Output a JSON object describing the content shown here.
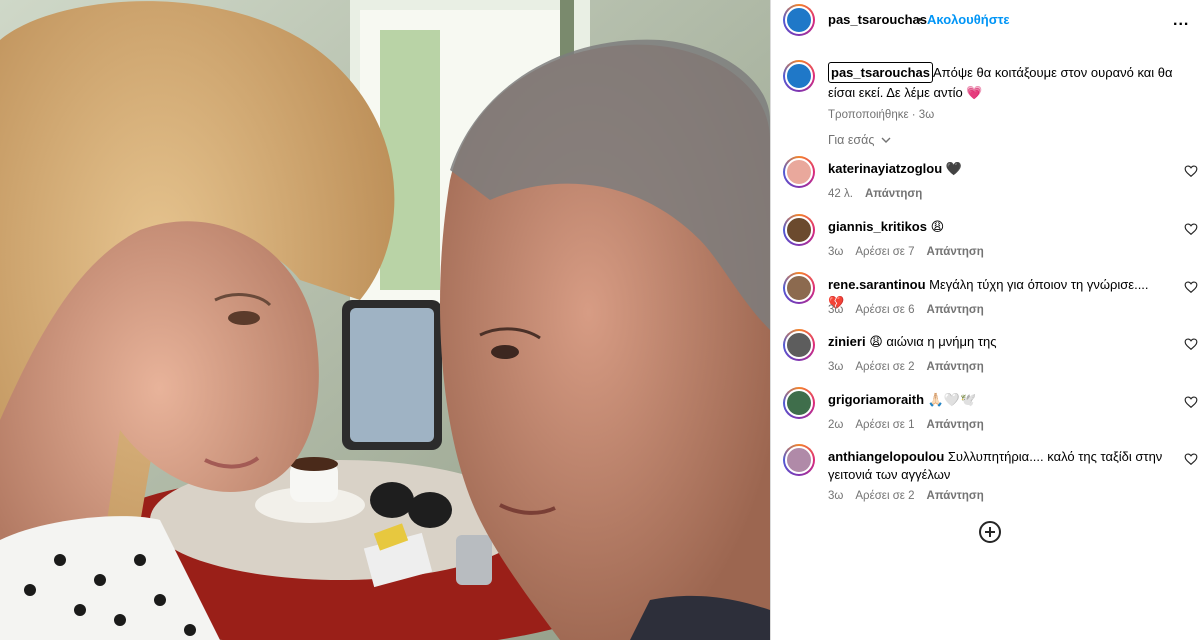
{
  "header": {
    "username": "pas_tsarouchas",
    "dot": "•",
    "follow_label": "Ακολουθήστε",
    "more_label": "..."
  },
  "caption": {
    "username": "pas_tsarouchas",
    "text": "Απόψε θα κοιτάξουμε στον ουρανό και θα είσαι εκεί. Δε λέμε αντίο",
    "emoji": "💗",
    "meta": "Τροποποιήθηκε · 3ω"
  },
  "for_you": {
    "label": "Για εσάς"
  },
  "comments": [
    {
      "username": "katerinayiatzoglou",
      "text": "🖤",
      "time": "42 λ.",
      "likes": "",
      "reply": "Απάντηση",
      "avatar_color": "#e9a89c"
    },
    {
      "username": "giannis_kritikos",
      "text": "😩",
      "time": "3ω",
      "likes": "Αρέσει σε 7",
      "reply": "Απάντηση",
      "avatar_color": "#6b4a2e"
    },
    {
      "username": "rene.sarantinou",
      "text": "Μεγάλη τύχη για όποιον τη γνώρισε....💔",
      "time": "3ω",
      "likes": "Αρέσει σε 6",
      "reply": "Απάντηση",
      "avatar_color": "#8c6a4f"
    },
    {
      "username": "zinieri",
      "text": "😩 αιώνια η μνήμη της",
      "time": "3ω",
      "likes": "Αρέσει σε 2",
      "reply": "Απάντηση",
      "avatar_color": "#5d5d5d"
    },
    {
      "username": "grigoriamoraith",
      "text": "🙏🏻🤍🕊️",
      "time": "2ω",
      "likes": "Αρέσει σε 1",
      "reply": "Απάντηση",
      "avatar_color": "#3f6e4b"
    },
    {
      "username": "anthiangelopoulou",
      "text": "Συλλυπητήρια.... καλό της ταξίδι στην γειτονιά των αγγέλων",
      "time": "3ω",
      "likes": "Αρέσει σε 2",
      "reply": "Απάντηση",
      "avatar_color": "#b08aa8"
    }
  ],
  "colors": {
    "accent": "#0095f6",
    "muted": "#737373",
    "heart": "#e0245e"
  },
  "icons": {
    "more": "more-icon",
    "like": "heart-icon",
    "add_comment": "plus-circle-icon",
    "chevron": "chevron-down-icon"
  }
}
